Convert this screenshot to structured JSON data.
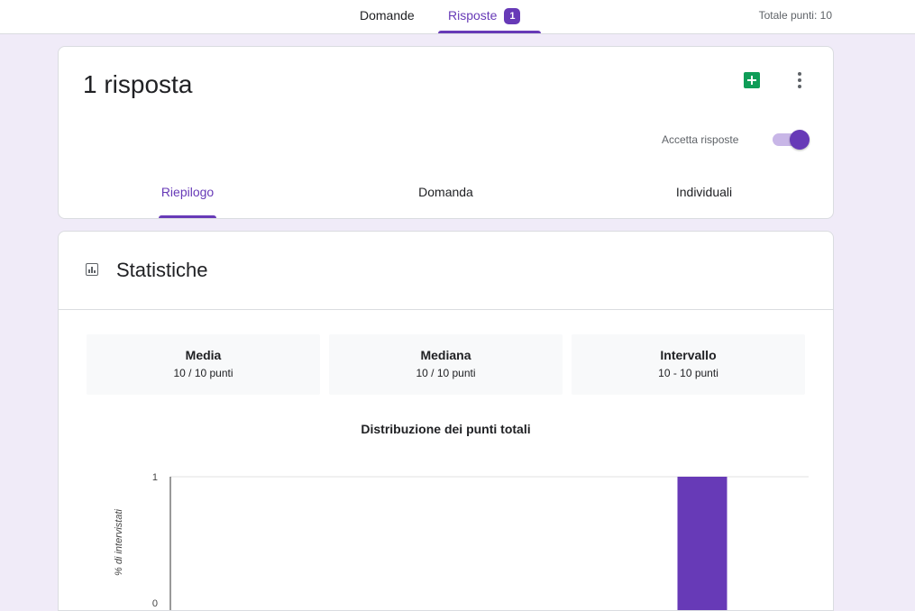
{
  "top_tabs": {
    "questions_label": "Domande",
    "responses_label": "Risposte",
    "responses_badge": "1"
  },
  "total_points": "Totale punti: 10",
  "summary_card": {
    "title": "1 risposta",
    "accept_label": "Accetta risposte",
    "accept_on": true,
    "tabs": [
      "Riepilogo",
      "Domanda",
      "Individuali"
    ],
    "active_tab": "Riepilogo"
  },
  "stats_card": {
    "title": "Statistiche",
    "boxes": [
      {
        "label": "Media",
        "value": "10 / 10 punti"
      },
      {
        "label": "Mediana",
        "value": "10 / 10 punti"
      },
      {
        "label": "Intervallo",
        "value": "10 - 10 punti"
      }
    ],
    "chart_title": "Distribuzione dei punti totali"
  },
  "chart_data": {
    "type": "bar",
    "title": "Distribuzione dei punti totali",
    "ylabel": "% di intervistati",
    "xlabel": "",
    "ylim": [
      0,
      1
    ],
    "y_ticks": [
      "1",
      "0"
    ],
    "x": [
      10
    ],
    "values": [
      1
    ],
    "xlim": [
      0,
      12
    ],
    "color": "#673ab7"
  },
  "colors": {
    "accent": "#673ab7",
    "background": "#f0ebf8",
    "sheets_green": "#0f9d58"
  }
}
